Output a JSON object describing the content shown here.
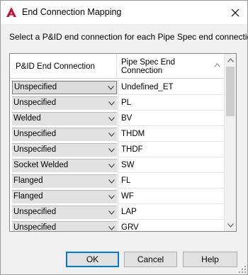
{
  "window": {
    "title": "End Connection Mapping",
    "close_label": "×"
  },
  "instructions": "Select a P&ID end connection for each Pipe Spec end connection.",
  "grid": {
    "headers": {
      "pid": "P&ID End Connection",
      "spec_line1": "Pipe Spec End",
      "spec_line2": "Connection"
    },
    "rows": [
      {
        "pid": "Unspecified",
        "spec": "Undefined_ET"
      },
      {
        "pid": "Unspecified",
        "spec": "PL"
      },
      {
        "pid": "Welded",
        "spec": "BV"
      },
      {
        "pid": "Unspecified",
        "spec": "THDM"
      },
      {
        "pid": "Unspecified",
        "spec": "THDF"
      },
      {
        "pid": "Socket Welded",
        "spec": "SW"
      },
      {
        "pid": "Flanged",
        "spec": "FL"
      },
      {
        "pid": "Flanged",
        "spec": "WF"
      },
      {
        "pid": "Unspecified",
        "spec": "LAP"
      },
      {
        "pid": "Unspecified",
        "spec": "GRV"
      }
    ]
  },
  "buttons": {
    "ok": "OK",
    "cancel": "Cancel",
    "help": "Help"
  },
  "colors": {
    "app_icon": "#c8102e",
    "focus_border": "#0078d7"
  },
  "icons": {
    "app": "autocad-a-icon",
    "close": "close-icon",
    "sort": "sort-ascending-icon",
    "dropdown": "chevron-down-icon",
    "resize": "resize-grip-icon"
  }
}
